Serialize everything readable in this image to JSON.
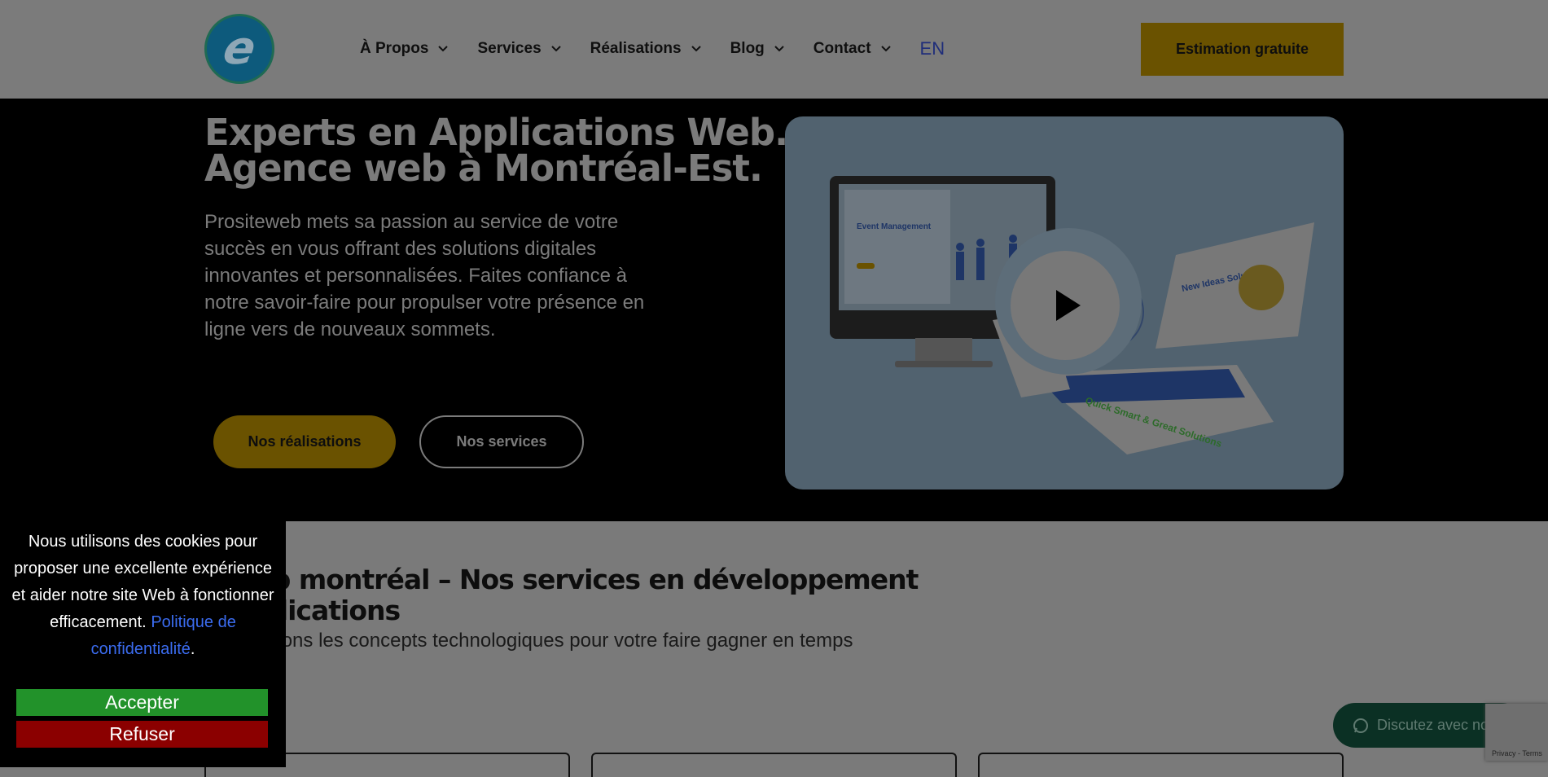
{
  "header": {
    "logo_letter": "e",
    "nav": [
      {
        "label": "À Propos",
        "has_dropdown": true
      },
      {
        "label": "Services",
        "has_dropdown": true
      },
      {
        "label": "Réalisations",
        "has_dropdown": true
      },
      {
        "label": "Blog",
        "has_dropdown": true
      },
      {
        "label": "Contact",
        "has_dropdown": true
      }
    ],
    "lang": "EN",
    "cta": "Estimation gratuite"
  },
  "hero": {
    "title_line1": "Experts en Applications Web.",
    "title_line2": "Agence web à Montréal-Est.",
    "description": "Prositeweb mets sa passion au service de votre succès en vous offrant des solutions digitales innovantes et personnalisées. Faites confiance à notre savoir-faire pour propulser votre présence en ligne vers de nouveaux sommets.",
    "btn_primary": "Nos réalisations",
    "btn_secondary": "Nos services",
    "media": {
      "screen_title": "Event Management",
      "card1_title": "New Ideas Solutions",
      "card2_title": "Quick Smart & Great Solutions",
      "play_icon": "play-icon"
    }
  },
  "section2": {
    "title_line1": "e web montréal – Nos services en développement",
    "title_line2": "t applications",
    "subtitle": "complexions les concepts technologiques pour votre faire gagner en temps"
  },
  "cookie": {
    "text": "Nous utilisons des cookies pour proposer une excellente expérience et aider notre site Web à fonctionner efficacement.",
    "link": "Politique de confidentialité",
    "period": ".",
    "accept": "Accepter",
    "refuse": "Refuser"
  },
  "chat": {
    "label": "Discutez avec nous",
    "icon": "whatsapp-icon"
  },
  "recaptcha": {
    "text": "Privacy - Terms"
  },
  "colors": {
    "accent": "#6a5200",
    "accept": "#22922a",
    "refuse": "#8b0000",
    "link": "#3b6cf0",
    "chat": "#0b3024"
  }
}
